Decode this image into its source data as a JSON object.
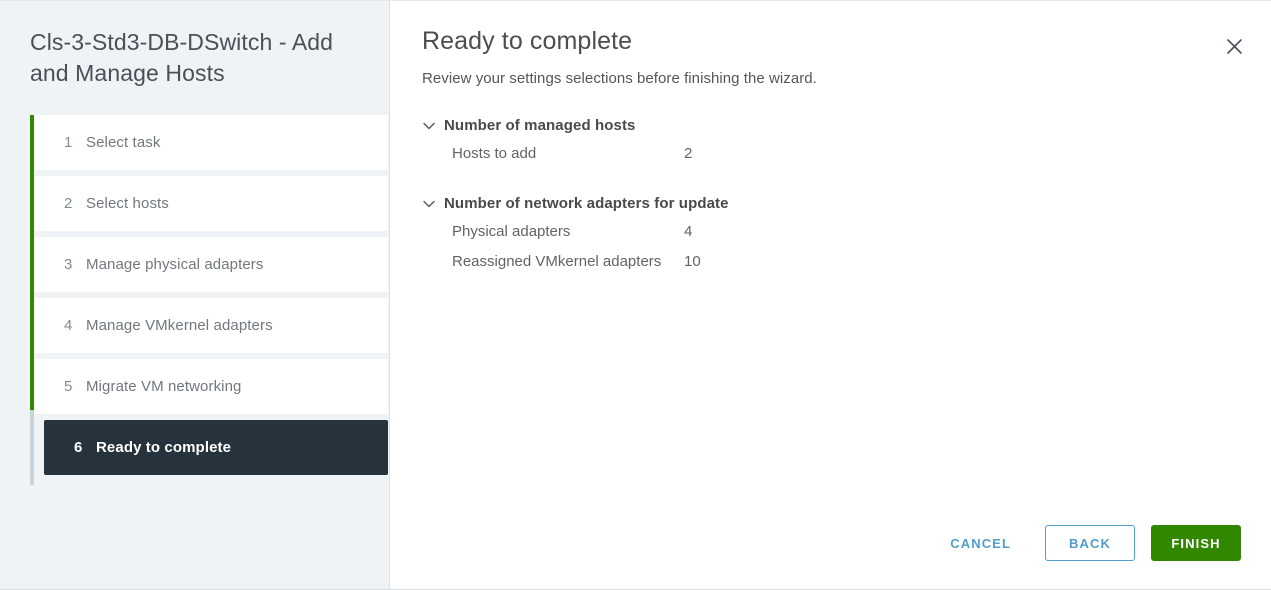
{
  "window": {
    "title": "Cls-3-Std3-DB-DSwitch - Add and Manage Hosts",
    "close_icon": "close-icon"
  },
  "sidebar": {
    "progress": {
      "completed_steps": 5,
      "total_steps": 6,
      "fill_color": "#318700",
      "track_color": "#c8d4da"
    },
    "steps": [
      {
        "number": "1",
        "label": "Select task",
        "state": "completed"
      },
      {
        "number": "2",
        "label": "Select hosts",
        "state": "completed"
      },
      {
        "number": "3",
        "label": "Manage physical adapters",
        "state": "completed"
      },
      {
        "number": "4",
        "label": "Manage VMkernel adapters",
        "state": "completed"
      },
      {
        "number": "5",
        "label": "Migrate VM networking",
        "state": "completed"
      },
      {
        "number": "6",
        "label": "Ready to complete",
        "state": "active"
      }
    ]
  },
  "main": {
    "title": "Ready to complete",
    "subtitle": "Review your settings selections before finishing the wizard.",
    "groups": [
      {
        "title": "Number of managed hosts",
        "expanded": true,
        "chevron_icon": "chevron-down-icon",
        "rows": [
          {
            "key": "Hosts to add",
            "value": "2"
          }
        ]
      },
      {
        "title": "Number of network adapters for update",
        "expanded": true,
        "chevron_icon": "chevron-down-icon",
        "rows": [
          {
            "key": "Physical adapters",
            "value": "4"
          },
          {
            "key": "Reassigned VMkernel adapters",
            "value": "10"
          }
        ]
      }
    ]
  },
  "footer": {
    "cancel_label": "CANCEL",
    "back_label": "BACK",
    "finish_label": "FINISH",
    "accent_blue": "#4f9ecb",
    "accent_green": "#318700"
  }
}
